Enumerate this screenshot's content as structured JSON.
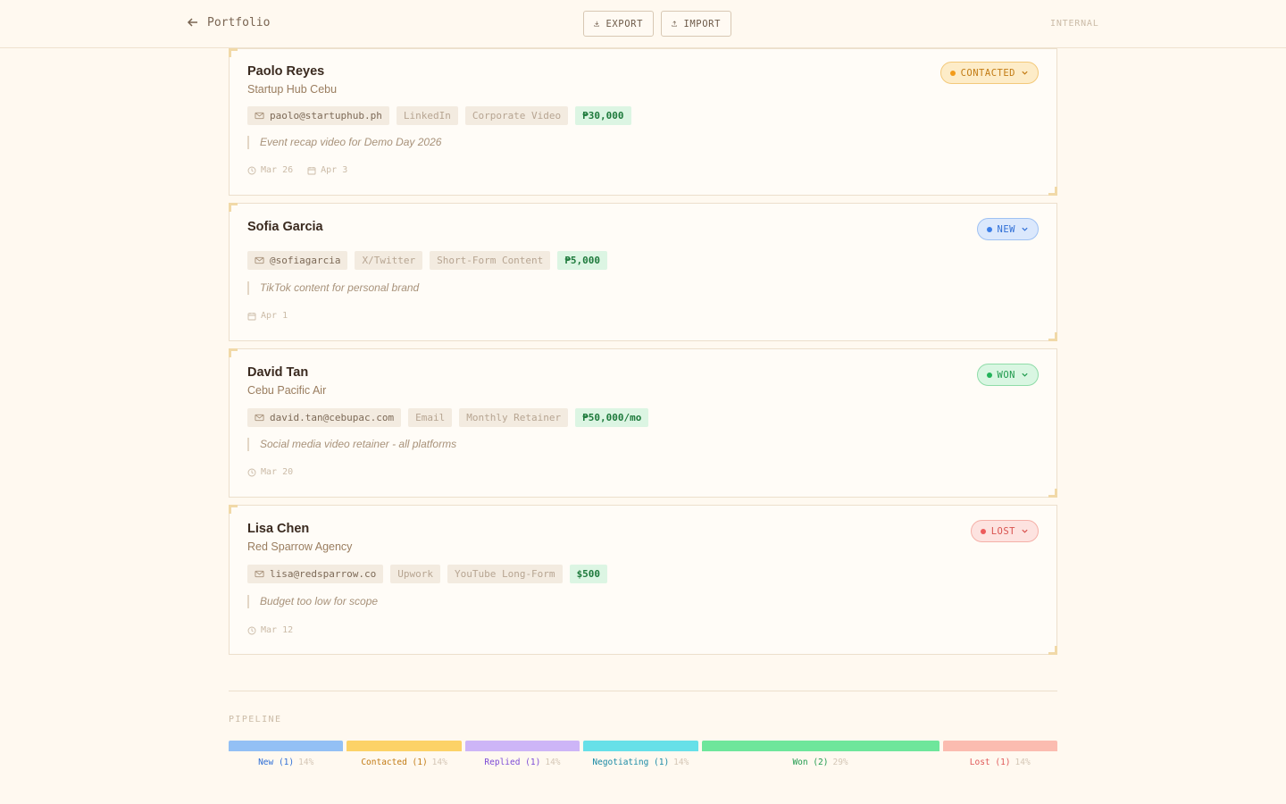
{
  "header": {
    "back_label": "Portfolio",
    "export_label": "EXPORT",
    "import_label": "IMPORT",
    "badge": "INTERNAL"
  },
  "leads": [
    {
      "name": "Paolo Reyes",
      "company": "Startup Hub Cebu",
      "status": "CONTACTED",
      "contact": "paolo@startuphub.ph",
      "channel": "LinkedIn",
      "service": "Corporate Video",
      "value": "₱30,000",
      "note": "Event recap video for Demo Day 2026",
      "date_created": "Mar 26",
      "date_due": "Apr 3"
    },
    {
      "name": "Sofia Garcia",
      "company": "",
      "status": "NEW",
      "contact": "@sofiagarcia",
      "channel": "X/Twitter",
      "service": "Short-Form Content",
      "value": "₱5,000",
      "note": "TikTok content for personal brand",
      "date_due": "Apr 1"
    },
    {
      "name": "David Tan",
      "company": "Cebu Pacific Air",
      "status": "WON",
      "contact": "david.tan@cebupac.com",
      "channel": "Email",
      "service": "Monthly Retainer",
      "value": "₱50,000/mo",
      "note": "Social media video retainer - all platforms",
      "date_created": "Mar 20"
    },
    {
      "name": "Lisa Chen",
      "company": "Red Sparrow Agency",
      "status": "LOST",
      "contact": "lisa@redsparrow.co",
      "channel": "Upwork",
      "service": "YouTube Long-Form",
      "value": "$500",
      "note": "Budget too low for scope",
      "date_created": "Mar 12"
    }
  ],
  "pipeline": {
    "title": "PIPELINE",
    "stages": [
      {
        "label": "New",
        "count": "(1)",
        "pct": "14%",
        "share": 0.14,
        "bar": "#93c0f5",
        "text": "#2f6fd6"
      },
      {
        "label": "Contacted",
        "count": "(1)",
        "pct": "14%",
        "share": 0.14,
        "bar": "#fcd267",
        "text": "#c27b14"
      },
      {
        "label": "Replied",
        "count": "(1)",
        "pct": "14%",
        "share": 0.14,
        "bar": "#cdb5f7",
        "text": "#7c4ad6"
      },
      {
        "label": "Negotiating",
        "count": "(1)",
        "pct": "14%",
        "share": 0.14,
        "bar": "#67e0e8",
        "text": "#1a8aa5"
      },
      {
        "label": "Won",
        "count": "(2)",
        "pct": "29%",
        "share": 0.29,
        "bar": "#6ee69b",
        "text": "#1f9a4d"
      },
      {
        "label": "Lost",
        "count": "(1)",
        "pct": "14%",
        "share": 0.14,
        "bar": "#fbbcb0",
        "text": "#e05858"
      }
    ]
  },
  "status_colors": {
    "CONTACTED": {
      "bg": "#fdecc8",
      "border": "#f3c97a",
      "text": "#c27b14",
      "dot": "#f29b1a"
    },
    "NEW": {
      "bg": "#dbe8fc",
      "border": "#9fc1f3",
      "text": "#2f6fd6",
      "dot": "#3b7ee8"
    },
    "WON": {
      "bg": "#d9f6e2",
      "border": "#8fdca8",
      "text": "#1f9a4d",
      "dot": "#22b35a"
    },
    "LOST": {
      "bg": "#fde3e0",
      "border": "#f5b0a8",
      "text": "#d9534f",
      "dot": "#ec5b5b"
    }
  }
}
